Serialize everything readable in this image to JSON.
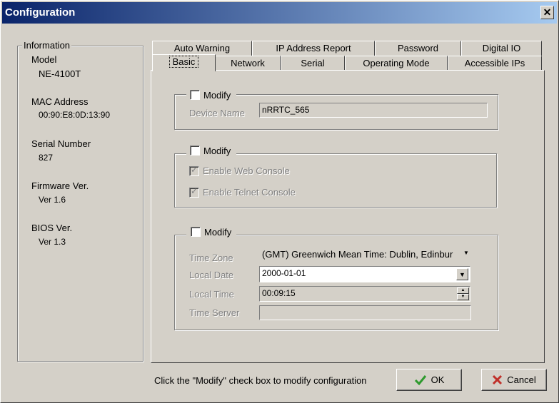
{
  "window": {
    "title": "Configuration"
  },
  "info": {
    "legend": "Information",
    "model_label": "Model",
    "model": "NE-4100T",
    "mac_label": "MAC Address",
    "mac": "00:90:E8:0D:13:90",
    "serial_label": "Serial Number",
    "serial": "827",
    "firmware_label": "Firmware Ver.",
    "firmware": "Ver 1.6",
    "bios_label": "BIOS Ver.",
    "bios": "Ver 1.3"
  },
  "tabs_back": [
    "Auto Warning",
    "IP Address Report",
    "Password",
    "Digital IO"
  ],
  "tabs_front": [
    "Basic",
    "Network",
    "Serial",
    "Operating Mode",
    "Accessible IPs"
  ],
  "basic": {
    "group1": {
      "modify": "Modify",
      "device_name_label": "Device Name",
      "device_name": "nRRTC_565"
    },
    "group2": {
      "modify": "Modify",
      "web_console": "Enable Web Console",
      "telnet_console": "Enable Telnet Console"
    },
    "group3": {
      "modify": "Modify",
      "timezone_label": "Time Zone",
      "timezone": "(GMT) Greenwich Mean Time: Dublin, Edinbur",
      "date_label": "Local Date",
      "date": "2000-01-01",
      "time_label": "Local Time",
      "time": "00:09:15",
      "server_label": "Time Server",
      "server": ""
    }
  },
  "footer": {
    "hint": "Click the \"Modify\" check box to modify configuration",
    "ok": "OK",
    "cancel": "Cancel"
  },
  "icons": {
    "ok": "check-icon",
    "cancel": "x-icon"
  },
  "colors": {
    "ok_icon": "#2e9a2e",
    "cancel_icon": "#c0302a",
    "title_start": "#0a246a",
    "title_end": "#a6caf0"
  }
}
